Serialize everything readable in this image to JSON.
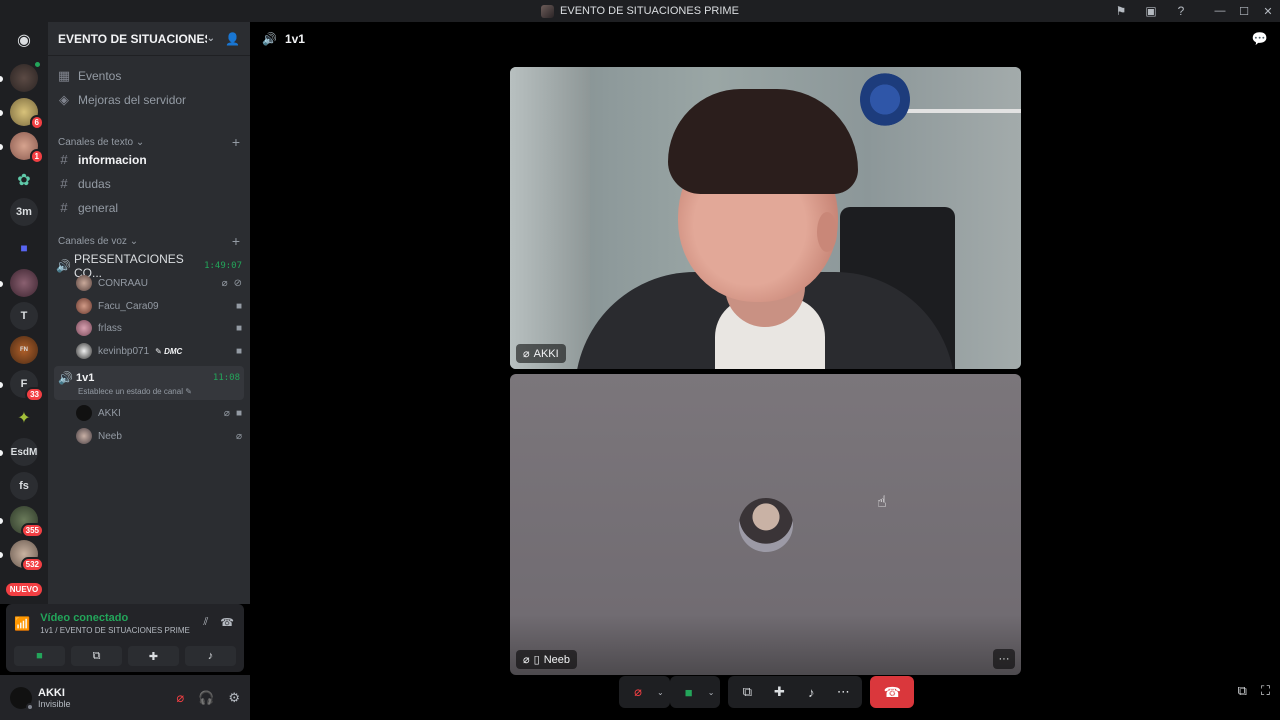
{
  "window": {
    "title": "EVENTO DE SITUACIONES PRIME",
    "controls": [
      "flag-icon",
      "monitor-icon",
      "help-icon",
      "minimize-icon",
      "maximize-icon",
      "close-icon"
    ]
  },
  "rail": {
    "servers": [
      {
        "label": "",
        "icon": "discord-home-icon"
      },
      {
        "label": "",
        "badge": ""
      },
      {
        "label": "",
        "badge": "6"
      },
      {
        "label": "",
        "badge": "1"
      },
      {
        "label": ""
      },
      {
        "label": "3m"
      },
      {
        "label": ""
      },
      {
        "label": ""
      },
      {
        "label": "T"
      },
      {
        "label": ""
      },
      {
        "label": "F",
        "badge": "33"
      },
      {
        "label": ""
      },
      {
        "label": "EsdM"
      },
      {
        "label": "fs"
      },
      {
        "label": "",
        "badge": "355"
      },
      {
        "label": "",
        "badge": "532"
      }
    ],
    "new_badge": "NUEVO"
  },
  "sidebar": {
    "guild_name": "EVENTO DE SITUACIONES ...",
    "links": [
      {
        "label": "Eventos",
        "icon": "calendar-icon"
      },
      {
        "label": "Mejoras del servidor",
        "icon": "boost-icon"
      }
    ],
    "text_category": "Canales de texto",
    "text_channels": [
      {
        "label": "informacion",
        "active": true
      },
      {
        "label": "dudas"
      },
      {
        "label": "general"
      }
    ],
    "voice_category": "Canales de voz",
    "voice_channels": [
      {
        "label": "PRESENTACIONES CO...",
        "timer": "1:49:07",
        "users": [
          {
            "name": "CONRAAU"
          },
          {
            "name": "Facu_Cara09"
          },
          {
            "name": "frlass"
          },
          {
            "name": "kevinbp071",
            "tag": "DMC"
          }
        ]
      },
      {
        "label": "1v1",
        "timer": "11:08",
        "status_hint": "Establece un estado de canal",
        "users": [
          {
            "name": "AKKI"
          },
          {
            "name": "Neeb"
          }
        ]
      }
    ]
  },
  "voice_panel": {
    "status": "Vídeo conectado",
    "location": "1v1 / EVENTO DE SITUACIONES PRIME"
  },
  "user_panel": {
    "name": "AKKI",
    "status": "Invisible"
  },
  "main": {
    "channel_name": "1v1",
    "tiles": [
      {
        "name": "AKKI"
      },
      {
        "name": "Neeb"
      }
    ],
    "more_label": "···"
  },
  "colors": {
    "accent_green": "#23a55a",
    "danger_red": "#da373c",
    "sidebar_bg": "#2b2d31",
    "rail_bg": "#1e1f22"
  }
}
